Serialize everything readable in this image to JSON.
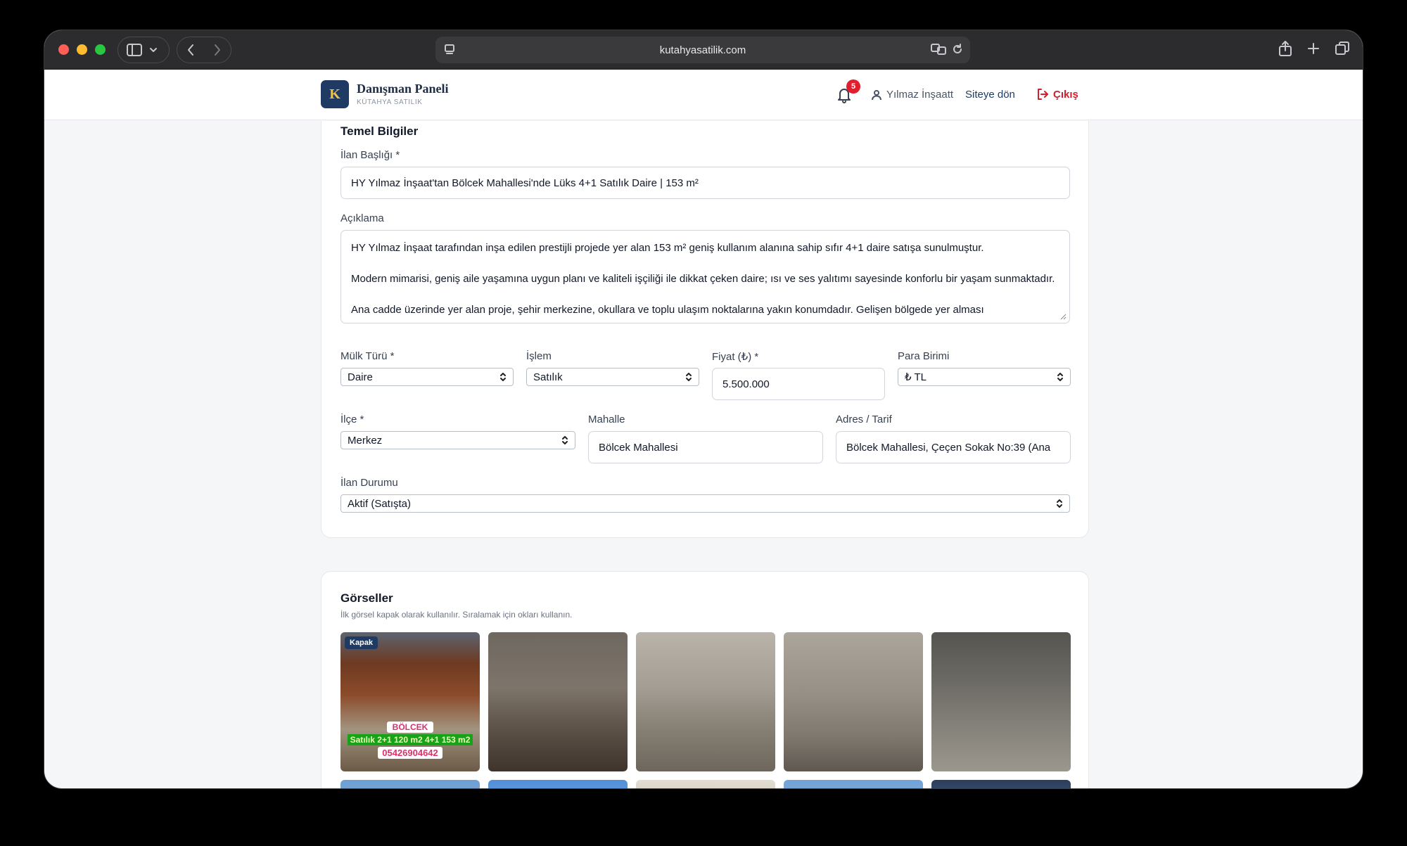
{
  "browser": {
    "url": "kutahyasatilik.com"
  },
  "header": {
    "brand_title": "Danışman Paneli",
    "brand_sub": "KÜTAHYA SATILIK",
    "logo_letter": "K",
    "notification_count": "5",
    "user_name": "Yılmaz İnşaatt",
    "back_to_site": "Siteye dön",
    "logout": "Çıkış"
  },
  "basic_info": {
    "section_title": "Temel Bilgiler",
    "title_label": "İlan Başlığı *",
    "title_value": "HY Yılmaz İnşaat'tan Bölcek Mahallesi'nde Lüks 4+1 Satılık Daire | 153 m²",
    "description_label": "Açıklama",
    "description_p1": "HY Yılmaz İnşaat tarafından inşa edilen prestijli projede yer alan 153 m² geniş kullanım alanına sahip sıfır 4+1 daire satışa sunulmuştur.",
    "description_p2": "Modern mimarisi, geniş aile yaşamına uygun planı ve kaliteli işçiliği ile dikkat çeken daire; ısı ve ses yalıtımı sayesinde konforlu bir yaşam sunmaktadır.",
    "description_p3": "Ana cadde üzerinde yer alan proje, şehir merkezine, okullara ve toplu ulaşım noktalarına yakın konumdadır. Gelişen bölgede yer alması",
    "property_type_label": "Mülk Türü *",
    "property_type_value": "Daire",
    "transaction_label": "İşlem",
    "transaction_value": "Satılık",
    "price_label": "Fiyat (₺) *",
    "price_value": "5.500.000",
    "currency_label": "Para Birimi",
    "currency_value": "₺ TL",
    "district_label": "İlçe *",
    "district_value": "Merkez",
    "neighborhood_label": "Mahalle",
    "neighborhood_value": "Bölcek Mahallesi",
    "address_label": "Adres / Tarif",
    "address_value": "Bölcek Mahallesi, Çeçen Sokak No:39 (Ana",
    "status_label": "İlan Durumu",
    "status_value": "Aktif (Satışta)"
  },
  "images": {
    "section_title": "Görseller",
    "hint": "İlk görsel kapak olarak kullanılır. Sıralamak için okları kullanın.",
    "cover_badge": "Kapak",
    "cover_overlay_name": "BÖLCEK",
    "cover_overlay_offer": "Satılık 2+1 120 m2  4+1 153 m2",
    "cover_overlay_phone": "05426904642"
  }
}
